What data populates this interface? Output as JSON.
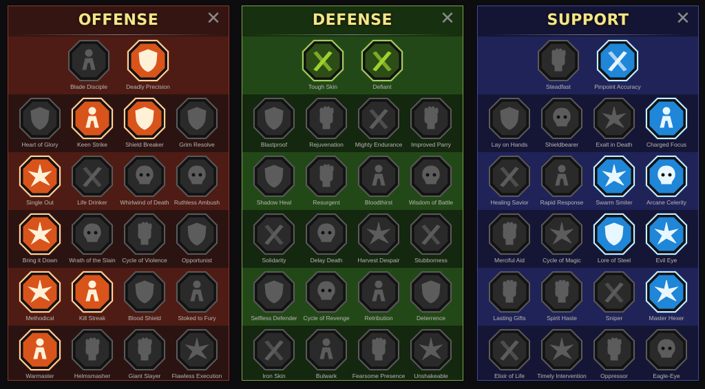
{
  "colors": {
    "active_orange": "#e8561e",
    "active_blue": "#2a9ff0",
    "active_green": "#7db52a",
    "inactive_gray": "#4a4a4a",
    "title_yellow": "#f3e58a"
  },
  "panels": [
    {
      "id": "offense",
      "title": "OFFENSE",
      "close_glyph": "✕",
      "rows": [
        [
          {
            "label": "Blade Disciple",
            "icon": "crossed-swords-icon",
            "state": "inactive"
          },
          {
            "label": "Deadly Precision",
            "icon": "dagger-strike-icon",
            "state": "active"
          }
        ],
        [
          {
            "label": "Heart of Glory",
            "icon": "horned-warrior-icon",
            "state": "inactive"
          },
          {
            "label": "Keen Strike",
            "icon": "arrow-strike-icon",
            "state": "active"
          },
          {
            "label": "Shield Breaker",
            "icon": "shield-break-icon",
            "state": "active"
          },
          {
            "label": "Grim Resolve",
            "icon": "heart-dagger-icon",
            "state": "inactive"
          }
        ],
        [
          {
            "label": "Single Out",
            "icon": "target-figure-icon",
            "state": "active"
          },
          {
            "label": "Life Drinker",
            "icon": "fangs-icon",
            "state": "inactive"
          },
          {
            "label": "Whirlwind of Death",
            "icon": "whirlwind-icon",
            "state": "inactive"
          },
          {
            "label": "Ruthless Ambush",
            "icon": "hand-dagger-icon",
            "state": "inactive"
          }
        ],
        [
          {
            "label": "Bring it Down",
            "icon": "sword-heart-icon",
            "state": "active"
          },
          {
            "label": "Wrath of the Slain",
            "icon": "fist-icon",
            "state": "inactive"
          },
          {
            "label": "Cycle of Violence",
            "icon": "axe-cycle-icon",
            "state": "inactive"
          },
          {
            "label": "Opportunist",
            "icon": "chains-lightning-icon",
            "state": "inactive"
          }
        ],
        [
          {
            "label": "Methodical",
            "icon": "burst-icon",
            "state": "active"
          },
          {
            "label": "Kill Streak",
            "icon": "skulls-icon",
            "state": "active"
          },
          {
            "label": "Blood Shield",
            "icon": "sword-shield-icon",
            "state": "inactive"
          },
          {
            "label": "Stoked to Fury",
            "icon": "rage-figure-icon",
            "state": "inactive"
          }
        ],
        [
          {
            "label": "Warmaster",
            "icon": "warmaster-icon",
            "state": "active"
          },
          {
            "label": "Helmsmasher",
            "icon": "helmet-icon",
            "state": "inactive"
          },
          {
            "label": "Giant Slayer",
            "icon": "giant-icon",
            "state": "inactive"
          },
          {
            "label": "Flawless Execution",
            "icon": "skull-swords-icon",
            "state": "inactive"
          }
        ]
      ]
    },
    {
      "id": "defense",
      "title": "DEFENSE",
      "close_glyph": "✕",
      "rows": [
        [
          {
            "label": "Tough Skin",
            "icon": "scales-icon",
            "state": "active"
          },
          {
            "label": "Defiant",
            "icon": "raised-fist-icon",
            "state": "active"
          }
        ],
        [
          {
            "label": "Blastproof",
            "icon": "chevron-shield-icon",
            "state": "inactive"
          },
          {
            "label": "Rejuvenation",
            "icon": "torso-icon",
            "state": "inactive"
          },
          {
            "label": "Mighty Endurance",
            "icon": "armored-figure-icon",
            "state": "inactive"
          },
          {
            "label": "Improved Parry",
            "icon": "crossed-blades-icon",
            "state": "inactive"
          }
        ],
        [
          {
            "label": "Shadow Heal",
            "icon": "shadow-figure-icon",
            "state": "inactive"
          },
          {
            "label": "Resurgent",
            "icon": "knight-shield-icon",
            "state": "inactive"
          },
          {
            "label": "Bloodthirst",
            "icon": "heart-skull-icon",
            "state": "inactive"
          },
          {
            "label": "Wisdom of Battle",
            "icon": "hooded-head-icon",
            "state": "inactive"
          }
        ],
        [
          {
            "label": "Solidarity",
            "icon": "group-icon",
            "state": "inactive"
          },
          {
            "label": "Delay Death",
            "icon": "hourglass-icon",
            "state": "inactive"
          },
          {
            "label": "Harvest Despair",
            "icon": "open-hand-icon",
            "state": "inactive"
          },
          {
            "label": "Stubborness",
            "icon": "bull-icon",
            "state": "inactive"
          }
        ],
        [
          {
            "label": "Selfless Defender",
            "icon": "defender-icon",
            "state": "inactive"
          },
          {
            "label": "Cycle of Revenge",
            "icon": "drops-icon",
            "state": "inactive"
          },
          {
            "label": "Retribution",
            "icon": "spiked-skull-icon",
            "state": "inactive"
          },
          {
            "label": "Deterrence",
            "icon": "deflect-icon",
            "state": "inactive"
          }
        ],
        [
          {
            "label": "Iron Skin",
            "icon": "iron-warrior-icon",
            "state": "inactive"
          },
          {
            "label": "Bulwark",
            "icon": "bulwark-icon",
            "state": "inactive"
          },
          {
            "label": "Fearsome Presence",
            "icon": "bearded-face-icon",
            "state": "inactive"
          },
          {
            "label": "Unshakeable",
            "icon": "stance-icon",
            "state": "inactive"
          }
        ]
      ]
    },
    {
      "id": "support",
      "title": "SUPPORT",
      "close_glyph": "✕",
      "rows": [
        [
          {
            "label": "Steadfast",
            "icon": "heart-plus-icon",
            "state": "inactive"
          },
          {
            "label": "Pinpoint Accuracy",
            "icon": "bullseye-icon",
            "state": "active"
          }
        ],
        [
          {
            "label": "Lay on Hands",
            "icon": "praying-hands-icon",
            "state": "inactive"
          },
          {
            "label": "Shieldbearer",
            "icon": "round-shield-icon",
            "state": "inactive"
          },
          {
            "label": "Exalt in Death",
            "icon": "flaming-skull-icon",
            "state": "inactive"
          },
          {
            "label": "Charged Focus",
            "icon": "charged-hand-icon",
            "state": "active"
          }
        ],
        [
          {
            "label": "Healing Savior",
            "icon": "healing-figure-icon",
            "state": "inactive"
          },
          {
            "label": "Rapid Response",
            "icon": "lightning-icon",
            "state": "inactive"
          },
          {
            "label": "Swarm Smiter",
            "icon": "swarm-icon",
            "state": "active"
          },
          {
            "label": "Arcane Celerity",
            "icon": "runner-icon",
            "state": "active"
          }
        ],
        [
          {
            "label": "Merciful Aid",
            "icon": "chained-heart-icon",
            "state": "inactive"
          },
          {
            "label": "Cycle of Magic",
            "icon": "comet-icon",
            "state": "inactive"
          },
          {
            "label": "Lore of Steel",
            "icon": "book-icon",
            "state": "active"
          },
          {
            "label": "Evil Eye",
            "icon": "evil-eye-icon",
            "state": "active"
          }
        ],
        [
          {
            "label": "Lasting Gifts",
            "icon": "compass-star-icon",
            "state": "inactive"
          },
          {
            "label": "Spirit Haste",
            "icon": "winged-boot-icon",
            "state": "inactive"
          },
          {
            "label": "Sniper",
            "icon": "eye-icon",
            "state": "inactive"
          },
          {
            "label": "Master Hexer",
            "icon": "voodoo-icon",
            "state": "active"
          }
        ],
        [
          {
            "label": "Elixir of Life",
            "icon": "potion-icon",
            "state": "inactive"
          },
          {
            "label": "Timely Intervention",
            "icon": "winged-skull-icon",
            "state": "inactive"
          },
          {
            "label": "Oppressor",
            "icon": "oppressor-icon",
            "state": "inactive"
          },
          {
            "label": "Eagle-Eye",
            "icon": "eagle-icon",
            "state": "inactive"
          }
        ]
      ]
    }
  ]
}
